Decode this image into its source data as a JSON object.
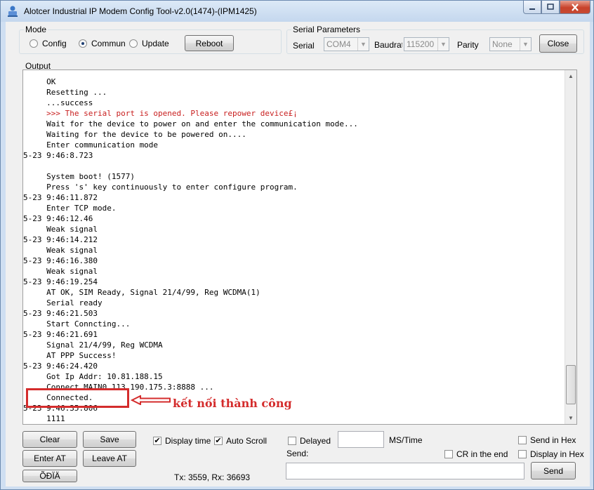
{
  "window": {
    "title": "Alotcer Industrial IP Modem Config Tool-v2.0(1474)-(IPM1425)",
    "minimize_icon": "minimize-icon",
    "maximize_icon": "maximize-icon",
    "close_icon": "close-icon"
  },
  "mode": {
    "legend": "Mode",
    "options": [
      {
        "label": "Config",
        "selected": false
      },
      {
        "label": "Commun",
        "selected": true
      },
      {
        "label": "Update",
        "selected": false
      }
    ],
    "reboot_label": "Reboot"
  },
  "serial": {
    "legend": "Serial Parameters",
    "serial_label": "Serial",
    "serial_value": "COM4",
    "baud_label": "Baudrat",
    "baud_value": "115200",
    "parity_label": "Parity",
    "parity_value": "None",
    "close_label": "Close"
  },
  "output": {
    "legend": "Output",
    "lines": [
      {
        "text": "     OK",
        "color": "normal"
      },
      {
        "text": "     Resetting ...",
        "color": "normal"
      },
      {
        "text": "     ...success",
        "color": "normal"
      },
      {
        "text": "     >>> The serial port is opened. Please repower device£¡",
        "color": "red"
      },
      {
        "text": "     Wait for the device to power on and enter the communication mode...",
        "color": "normal"
      },
      {
        "text": "     Waiting for the device to be powered on....",
        "color": "normal"
      },
      {
        "text": "     Enter communication mode",
        "color": "normal"
      },
      {
        "text": "5-23 9:46:8.723",
        "color": "normal"
      },
      {
        "text": "",
        "color": "normal"
      },
      {
        "text": "     System boot! (1577)",
        "color": "normal"
      },
      {
        "text": "     Press 's' key continuously to enter configure program.",
        "color": "normal"
      },
      {
        "text": "5-23 9:46:11.872",
        "color": "normal"
      },
      {
        "text": "     Enter TCP mode.",
        "color": "normal"
      },
      {
        "text": "5-23 9:46:12.46",
        "color": "normal"
      },
      {
        "text": "     Weak signal",
        "color": "normal"
      },
      {
        "text": "5-23 9:46:14.212",
        "color": "normal"
      },
      {
        "text": "     Weak signal",
        "color": "normal"
      },
      {
        "text": "5-23 9:46:16.380",
        "color": "normal"
      },
      {
        "text": "     Weak signal",
        "color": "normal"
      },
      {
        "text": "5-23 9:46:19.254",
        "color": "normal"
      },
      {
        "text": "     AT OK, SIM Ready, Signal 21/4/99, Reg WCDMA(1)",
        "color": "normal"
      },
      {
        "text": "     Serial ready",
        "color": "normal"
      },
      {
        "text": "5-23 9:46:21.503",
        "color": "normal"
      },
      {
        "text": "     Start Conncting...",
        "color": "normal"
      },
      {
        "text": "5-23 9:46:21.691",
        "color": "normal"
      },
      {
        "text": "     Signal 21/4/99, Reg WCDMA",
        "color": "normal"
      },
      {
        "text": "     AT PPP Success!",
        "color": "normal"
      },
      {
        "text": "5-23 9:46:24.420",
        "color": "normal"
      },
      {
        "text": "     Got Ip Addr: 10.81.188.15",
        "color": "normal"
      },
      {
        "text": "     Connect MAIN0 113.190.175.3:8888 ...",
        "color": "normal"
      },
      {
        "text": "     Connected.",
        "color": "normal"
      },
      {
        "text": "5-23 9:46:35.806",
        "color": "normal"
      },
      {
        "text": "     1111",
        "color": "normal"
      }
    ],
    "annotation": "kết nối thành công"
  },
  "controls": {
    "clear_label": "Clear",
    "save_label": "Save",
    "enter_at_label": "Enter AT",
    "leave_at_label": "Leave AT",
    "extra_label": "ÕÐÏÄ",
    "display_time_label": "Display time",
    "display_time_checked": true,
    "auto_scroll_label": "Auto Scroll",
    "auto_scroll_checked": true,
    "counters": "Tx: 3559, Rx: 36693",
    "delayed_label": "Delayed",
    "delayed_checked": false,
    "ms_time_label": "MS/Time",
    "ms_value": "",
    "send_label": "Send:",
    "send_value": "",
    "send_in_hex_label": "Send in Hex",
    "send_in_hex_checked": false,
    "cr_label": "CR in the end",
    "cr_checked": false,
    "display_in_hex_label": "Display in Hex",
    "display_in_hex_checked": false,
    "send_button_label": "Send"
  }
}
